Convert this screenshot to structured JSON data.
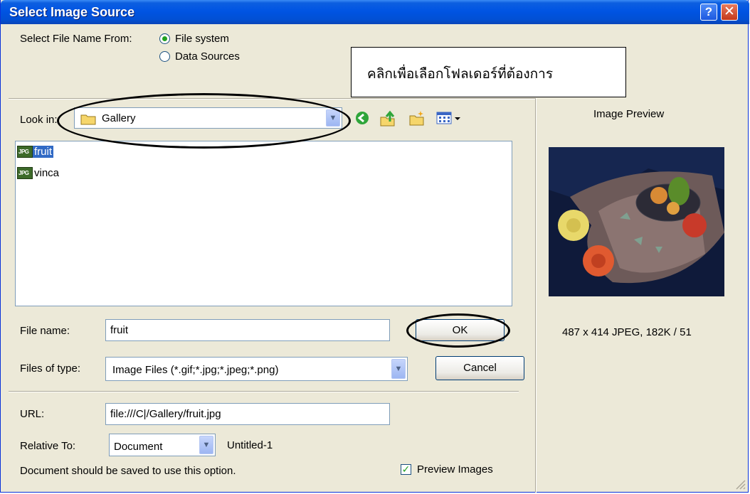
{
  "window": {
    "title": "Select Image Source"
  },
  "source": {
    "label": "Select File Name From:",
    "options": [
      "File system",
      "Data Sources"
    ],
    "selected": "File system"
  },
  "callout": {
    "text": "คลิกเพื่อเลือกโฟลเดอร์ที่ต้องการ"
  },
  "look_in": {
    "label": "Look in:",
    "value": "Gallery"
  },
  "files": [
    {
      "name": "fruit",
      "icon": "jpg-file-icon",
      "selected": true
    },
    {
      "name": "vinca",
      "icon": "jpg-file-icon",
      "selected": false
    }
  ],
  "file_name": {
    "label": "File name:",
    "value": "fruit"
  },
  "files_of_type": {
    "label": "Files of type:",
    "value": "Image Files (*.gif;*.jpg;*.jpeg;*.png)"
  },
  "buttons": {
    "ok": "OK",
    "cancel": "Cancel"
  },
  "url": {
    "label": "URL:",
    "value": "file:///C|/Gallery/fruit.jpg"
  },
  "relative_to": {
    "label": "Relative To:",
    "value": "Document",
    "doc_name": "Untitled-1"
  },
  "note": "Document should be saved to use this option.",
  "preview_images": {
    "label": "Preview Images",
    "checked": true
  },
  "image_preview": {
    "heading": "Image Preview",
    "info": "487 x 414 JPEG, 182K / 51"
  },
  "colors": {
    "titlebar": "#0054e3",
    "dialog_bg": "#ece9d8",
    "selection": "#316ac5"
  }
}
